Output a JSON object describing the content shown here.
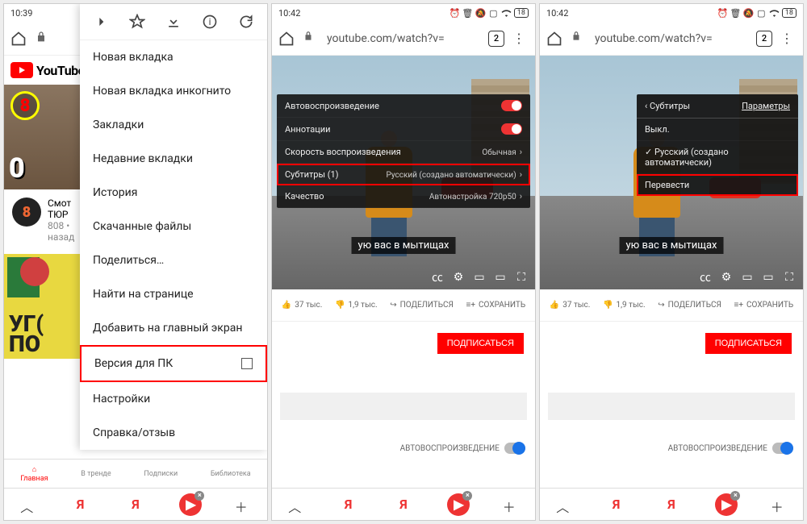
{
  "status": {
    "time1": "10:39",
    "time23": "10:42",
    "battery": "18"
  },
  "urlbar": {
    "url": "youtube.com/watch?v=",
    "tabcount": "2"
  },
  "menu_top_icons": [
    "forward",
    "star",
    "download",
    "info",
    "reload"
  ],
  "menu": {
    "new_tab": "Новая вкладка",
    "incognito": "Новая вкладка инкогнито",
    "bookmarks": "Закладки",
    "recent": "Недавние вкладки",
    "history": "История",
    "downloads": "Скачанные файлы",
    "share": "Поделиться…",
    "find": "Найти на странице",
    "addhome": "Добавить на главный экран",
    "desktop": "Версия для ПК",
    "settings": "Настройки",
    "help": "Справка/отзыв"
  },
  "yt": {
    "brand": "YouTube",
    "vid1_title": "Смот",
    "vid1_sub": "ТЮР",
    "vid1_meta1": "808 •",
    "vid1_meta2": "назад",
    "thumb2_line1": "УГ(",
    "thumb2_line2": "ПО",
    "tabs": {
      "home": "Главная",
      "trending": "В тренде",
      "subs": "Подписки",
      "library": "Библиотека"
    }
  },
  "player": {
    "autoplay": "Автовоспроизведение",
    "annotations": "Аннотации",
    "speed": "Скорость воспроизведения",
    "speed_val": "Обычная",
    "subtitles": "Субтитры (1)",
    "subtitles_val": "Русский (создано автоматически)",
    "quality": "Качество",
    "quality_val": "Автонастройка 720p50",
    "caption": "ую вас в мытищах"
  },
  "subpanel": {
    "back": "Субтитры",
    "params": "Параметры",
    "off": "Выкл.",
    "russian": "Русский (создано автоматически)",
    "translate": "Перевести"
  },
  "actions": {
    "likes": "37 тыс.",
    "dislikes": "1,9 тыс.",
    "share": "ПОДЕЛИТЬСЯ",
    "save": "СОХРАНИТЬ",
    "subscribe": "ПОДПИСАТЬСЯ",
    "autoplay_label": "АВТОВОСПРОИЗВЕДЕНИЕ"
  }
}
